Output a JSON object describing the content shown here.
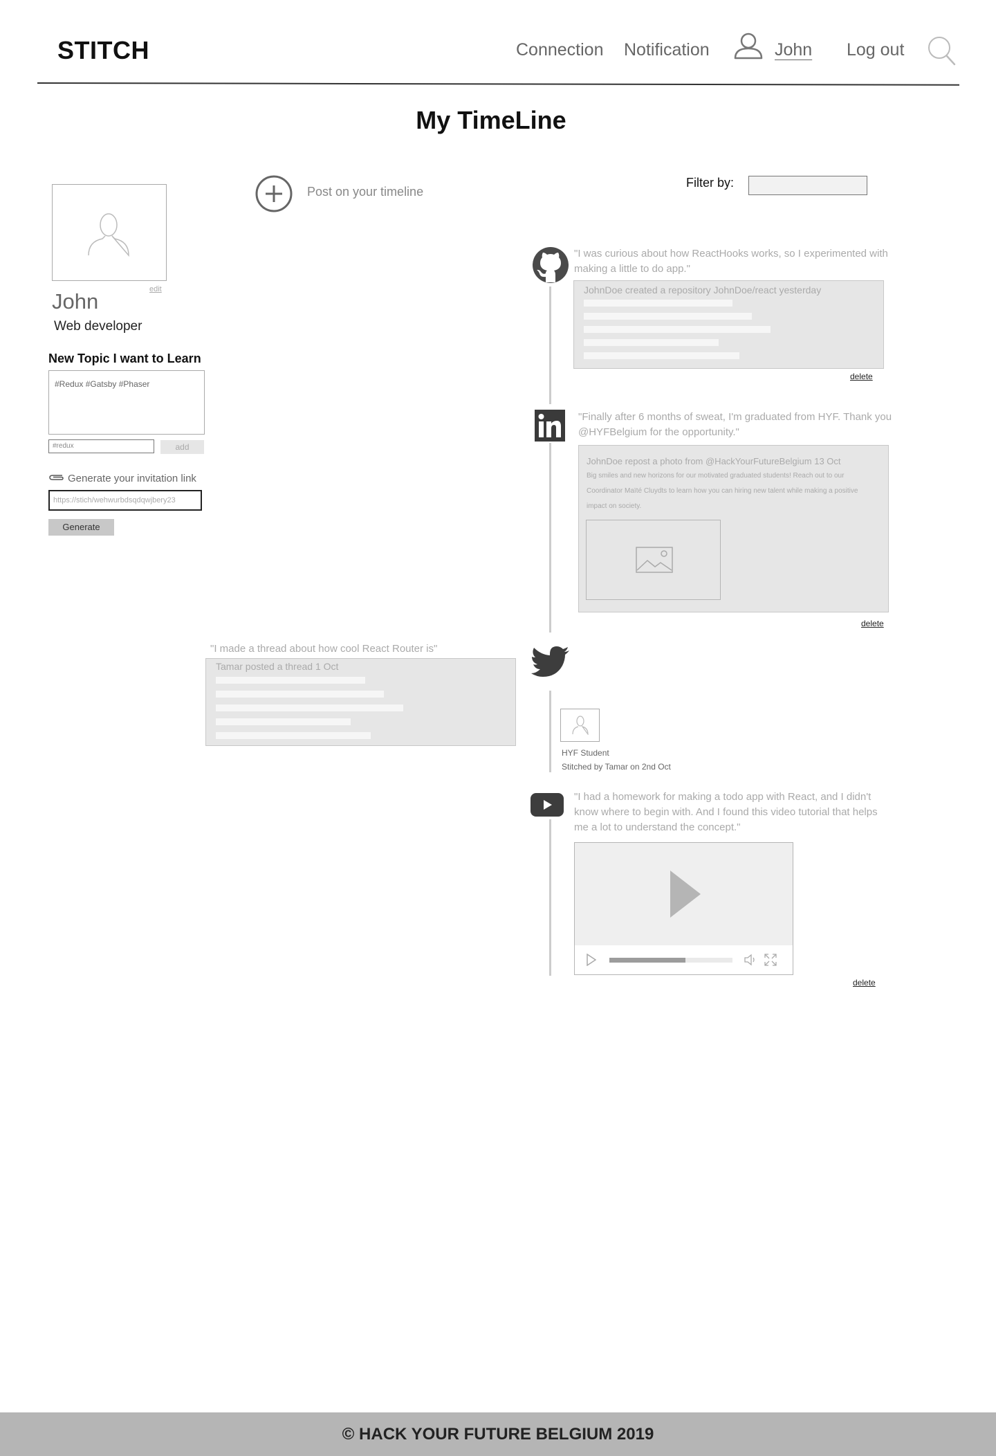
{
  "header": {
    "logo": "STITCH",
    "nav": {
      "connection": "Connection",
      "notification": "Notification",
      "user": "John",
      "logout": "Log out"
    }
  },
  "page_title": "My TimeLine",
  "profile": {
    "edit_label": "edit",
    "name": "John",
    "role": "Web developer",
    "topics_heading": "New Topic I want to Learn",
    "topics": "#Redux #Gatsby #Phaser",
    "topic_input_value": "#redux",
    "add_label": "add",
    "invite_label": "Generate your invitation link",
    "invite_link": "https://stich/wehwurbdsqdqwjbery23",
    "generate_label": "Generate"
  },
  "composer": {
    "post_label": "Post on your timeline",
    "filter_label": "Filter by:"
  },
  "timeline": {
    "github": {
      "icon": "github-icon",
      "quote": "\"I was curious about how ReactHooks works, so I experimented with making a little to do app.\"",
      "card_title": "JohnDoe created a repository JohnDoe/react yesterday",
      "delete_label": "delete"
    },
    "linkedin": {
      "icon": "linkedin-icon",
      "quote": "\"Finally after 6 months of sweat, I'm graduated from HYF. Thank you @HYFBelgium for the opportunity.\"",
      "card_title": "JohnDoe repost a photo from @HackYourFutureBelgium 13 Oct",
      "card_body": "Big smiles and new horizons for our motivated graduated students! Reach out to our Coordinator Maïté Cluydts to learn how you can hiring new talent while making a positive impact on society.",
      "delete_label": "delete"
    },
    "twitter": {
      "icon": "twitter-icon",
      "quote": "\"I made a thread about how cool React Router is\"",
      "card_title": "Tamar posted a thread  1 Oct"
    },
    "stitch": {
      "role": "HYF Student",
      "stitched_by": "Stitched by Tamar on 2nd Oct"
    },
    "youtube": {
      "icon": "youtube-icon",
      "quote": "\"I had a homework for making a todo app with React, and I didn't know where to begin with. And I found this video tutorial that helps me a lot to understand the concept.\"",
      "progress": 0.62,
      "delete_label": "delete"
    }
  },
  "footer": {
    "text": "© HACK YOUR FUTURE BELGIUM 2019"
  }
}
